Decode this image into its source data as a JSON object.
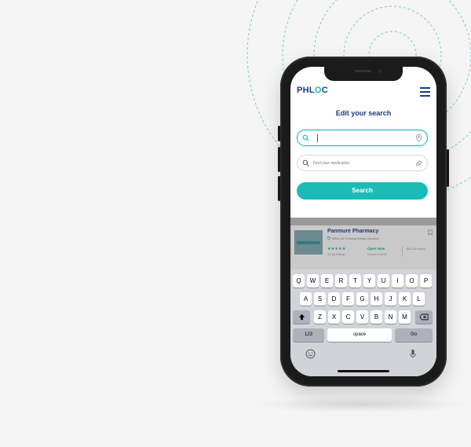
{
  "app": {
    "logo_prefix": "PHL",
    "logo_o": "O",
    "logo_suffix": "C",
    "menu_icon": "hamburger-menu-icon"
  },
  "search_form": {
    "title": "Edit your search",
    "location_field": {
      "value": "",
      "placeholder": "",
      "left_icon": "search-icon",
      "right_icon": "location-pin-icon"
    },
    "medication_field": {
      "value": "",
      "placeholder": "Find your medication",
      "left_icon": "search-icon",
      "right_icon": "pill-icon"
    },
    "submit_label": "Search"
  },
  "result_card": {
    "name": "Panmure Pharmacy",
    "address": "980m | 42 Ti Irirangi Avenue, Manukau",
    "stars": "★★★★★",
    "rating": "4.6 (3) Ratings",
    "status": "Open Now",
    "closes": "Closes at 18:00",
    "distance": "$6/10 at review"
  },
  "keyboard": {
    "row1": [
      "Q",
      "W",
      "E",
      "R",
      "T",
      "Y",
      "U",
      "I",
      "O",
      "P"
    ],
    "row2": [
      "A",
      "S",
      "D",
      "F",
      "G",
      "H",
      "J",
      "K",
      "L"
    ],
    "row3": [
      "Z",
      "X",
      "C",
      "V",
      "B",
      "N",
      "M"
    ],
    "shift_icon": "shift-icon",
    "backspace_icon": "backspace-icon",
    "numbers_label": "123",
    "space_label": "space",
    "go_label": "Go",
    "emoji_icon": "emoji-icon",
    "mic_icon": "microphone-icon"
  },
  "colors": {
    "brand_navy": "#1b3c7a",
    "brand_teal": "#1bbcb8",
    "background": "#f5f5f5"
  }
}
